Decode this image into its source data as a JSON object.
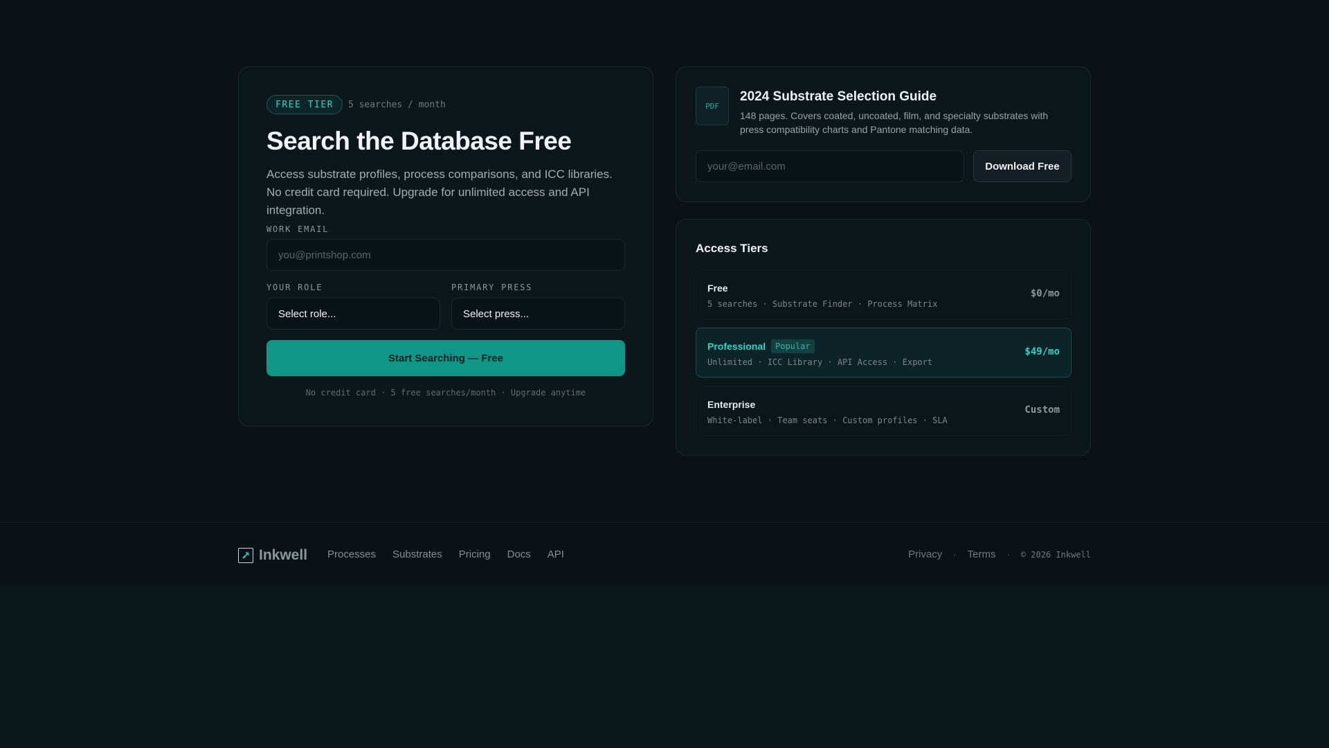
{
  "signup": {
    "badge": "FREE TIER",
    "badge_note": "5 searches / month",
    "title": "Search the Database Free",
    "subtitle": "Access substrate profiles, process comparisons, and ICC libraries. No credit card required. Upgrade for unlimited access and API integration.",
    "email_label": "WORK EMAIL",
    "email_placeholder": "you@printshop.com",
    "role_label": "YOUR ROLE",
    "role_value": "Select role...",
    "press_label": "PRIMARY PRESS",
    "press_value": "Select press...",
    "submit_label": "Start Searching — Free",
    "fineprint": "No credit card · 5 free searches/month · Upgrade anytime"
  },
  "guide": {
    "icon_label": "PDF",
    "title": "2024 Substrate Selection Guide",
    "description": "148 pages. Covers coated, uncoated, film, and specialty substrates with press compatibility charts and Pantone matching data.",
    "email_placeholder": "your@email.com",
    "download_label": "Download Free"
  },
  "tiers": {
    "heading": "Access Tiers",
    "items": [
      {
        "name": "Free",
        "features": "5 searches · Substrate Finder · Process Matrix",
        "price": "$0/mo"
      },
      {
        "name": "Professional",
        "badge": "Popular",
        "features": "Unlimited · ICC Library · API Access · Export",
        "price": "$49/mo"
      },
      {
        "name": "Enterprise",
        "features": "White-label · Team seats · Custom profiles · SLA",
        "price": "Custom"
      }
    ]
  },
  "footer": {
    "brand": "Inkwell",
    "nav": [
      "Processes",
      "Substrates",
      "Pricing",
      "Docs",
      "API"
    ],
    "privacy": "Privacy",
    "terms": "Terms",
    "copyright": "© 2026 Inkwell"
  },
  "colors": {
    "background": "#0a1218",
    "accent": "#2fd4c6",
    "primary_button": "#0f9687"
  }
}
